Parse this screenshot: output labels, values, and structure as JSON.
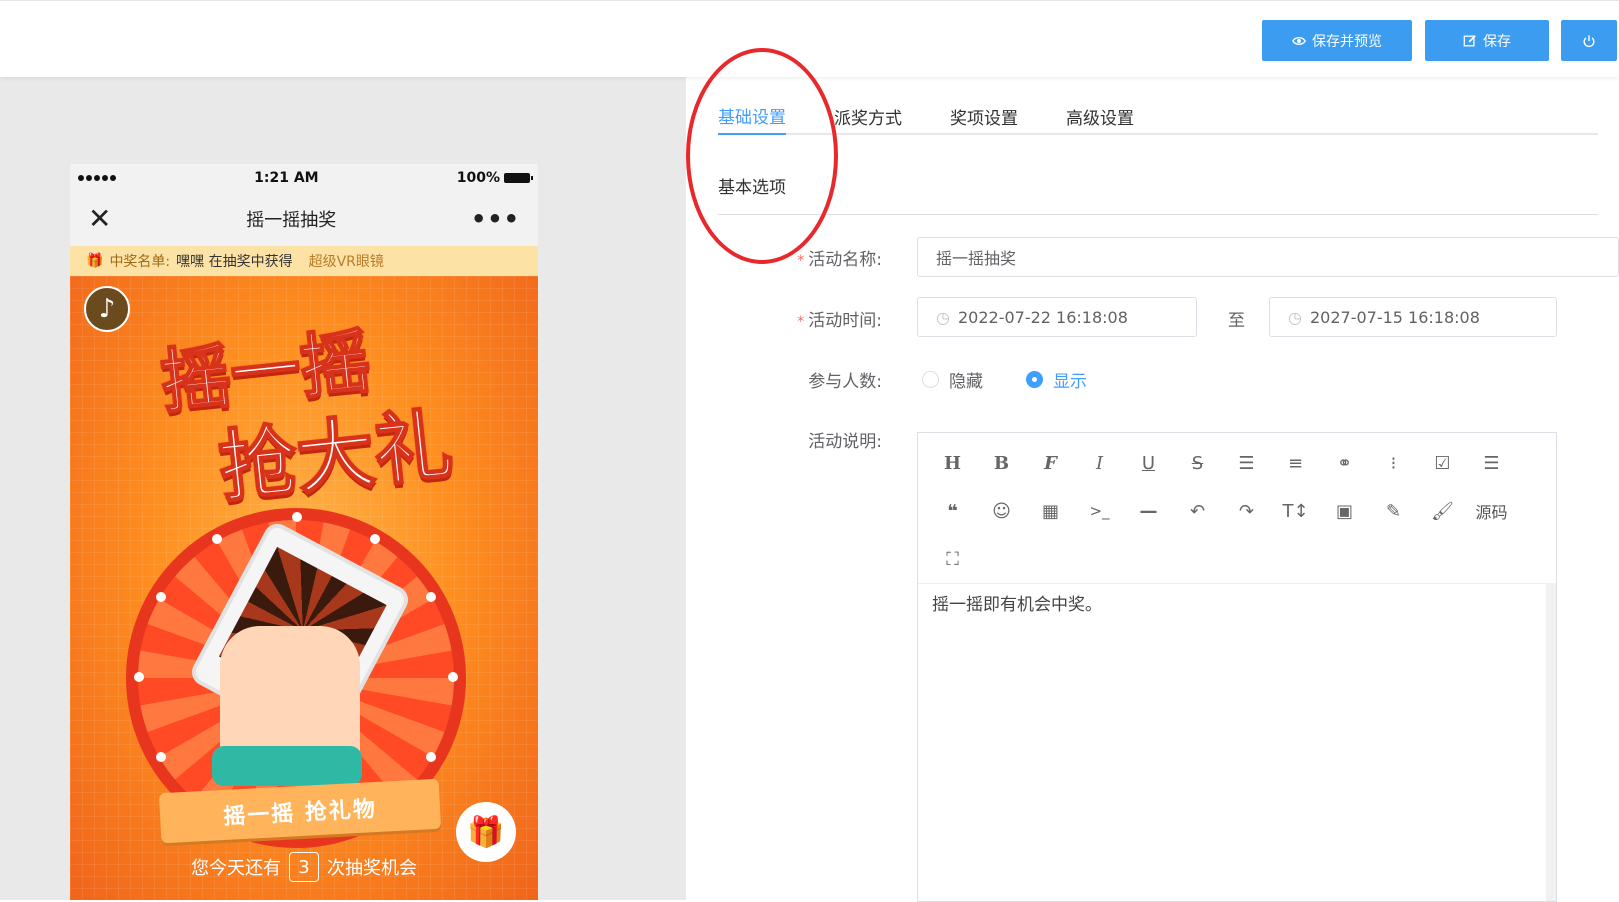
{
  "toolbar": {
    "save_preview_label": "保存并预览",
    "save_label": "保存"
  },
  "phone": {
    "time": "1:21 AM",
    "battery": "100%",
    "title": "摇一摇抽奖",
    "winner_prefix": "中奖名单:",
    "winner_name": "嘿嘿 在抽奖中获得",
    "winner_prize": "超级VR眼镜",
    "headline_line1": "摇一摇",
    "headline_line2": "抢大礼",
    "ribbon_text": "摇一摇 抢礼物",
    "chance_prefix": "您今天还有",
    "chance_count": "3",
    "chance_suffix": "次抽奖机会"
  },
  "tabs": [
    {
      "label": "基础设置",
      "active": true
    },
    {
      "label": "派奖方式",
      "active": false
    },
    {
      "label": "奖项设置",
      "active": false
    },
    {
      "label": "高级设置",
      "active": false
    }
  ],
  "form": {
    "section_title": "基本选项",
    "name_label": "活动名称:",
    "name_value": "摇一摇抽奖",
    "time_label": "活动时间:",
    "start_time": "2022-07-22 16:18:08",
    "to_label": "至",
    "end_time": "2027-07-15 16:18:08",
    "participants_label": "参与人数:",
    "hide_label": "隐藏",
    "show_label": "显示",
    "selected": "显示",
    "desc_label": "活动说明:",
    "desc_value": "摇一摇即有机会中奖。",
    "source_label": "源码"
  },
  "colors": {
    "primary": "#409eff",
    "button": "#3b9cf0",
    "annotation": "#e8292c"
  }
}
